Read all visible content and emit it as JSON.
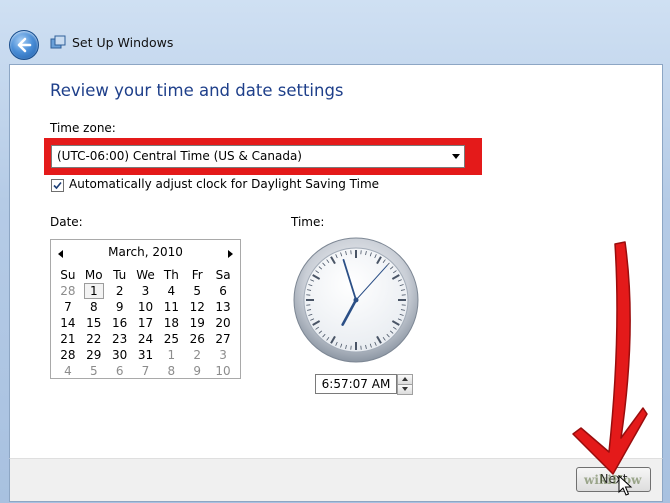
{
  "window": {
    "title": "Set Up Windows"
  },
  "page": {
    "heading": "Review your time and date settings"
  },
  "timezone": {
    "label": "Time zone:",
    "value": "(UTC-06:00) Central Time (US & Canada)",
    "highlight_color": "#e41a1a"
  },
  "dst": {
    "label": "Automatically adjust clock for Daylight Saving Time",
    "checked": true
  },
  "date": {
    "label": "Date:",
    "month": "March, 2010",
    "weekdays": [
      "Su",
      "Mo",
      "Tu",
      "We",
      "Th",
      "Fr",
      "Sa"
    ],
    "weeks": [
      [
        "28",
        "1",
        "2",
        "3",
        "4",
        "5",
        "6"
      ],
      [
        "7",
        "8",
        "9",
        "10",
        "11",
        "12",
        "13"
      ],
      [
        "14",
        "15",
        "16",
        "17",
        "18",
        "19",
        "20"
      ],
      [
        "21",
        "22",
        "23",
        "24",
        "25",
        "26",
        "27"
      ],
      [
        "28",
        "29",
        "30",
        "31",
        "1",
        "2",
        "3"
      ],
      [
        "4",
        "5",
        "6",
        "7",
        "8",
        "9",
        "10"
      ]
    ]
  },
  "time": {
    "label": "Time:",
    "value": "6:57:07 AM"
  },
  "footer": {
    "next_label": "Next",
    "watermark": "wikiHow"
  }
}
